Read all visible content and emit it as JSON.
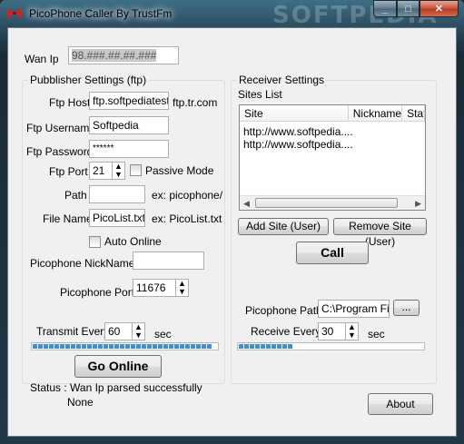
{
  "window": {
    "title": "PicoPhone Caller By TrustFm",
    "watermark": "SOFTPEDIA",
    "icon": "red-bowtie-icon",
    "minimize_icon": "minimize-icon",
    "maximize_icon": "maximize-icon",
    "close_icon": "close-icon",
    "minimize_glyph": "_",
    "maximize_glyph": "□",
    "close_glyph": "✕"
  },
  "wan": {
    "label": "Wan Ip",
    "value": "98.###.##.##.### "
  },
  "publisher": {
    "title": "Pubblisher Settings (ftp)",
    "ftp_host_label": "Ftp Host",
    "ftp_host_value": "ftp.softpediatest.c",
    "ftp_host_suffix": "ftp.tr.com",
    "ftp_username_label": "Ftp Username",
    "ftp_username_value": "Softpedia",
    "ftp_password_label": "Ftp Password",
    "ftp_password_value": "******",
    "ftp_port_label": "Ftp Port",
    "ftp_port_value": "21",
    "passive_mode_label": "Passive Mode",
    "passive_mode_checked": false,
    "path_label": "Path",
    "path_value": "",
    "path_example": "ex: picophone/",
    "file_name_label": "File Name",
    "file_name_value": "PicoList.txt",
    "file_name_example": "ex: PicoList.txt",
    "auto_online_label": "Auto Online",
    "auto_online_checked": false,
    "nickname_label": "Picophone NickName",
    "nickname_value": "",
    "port_label": "Picophone Port",
    "port_value": "11676",
    "transmit_label": "Transmit Every",
    "transmit_value": "60",
    "transmit_unit": "sec",
    "progress_percent": 100,
    "go_online_label": "Go Online",
    "status_label": "Status :",
    "status_line1": "Wan Ip parsed successfully",
    "status_line2": "None"
  },
  "receiver": {
    "title": "Receiver Settings",
    "sites_list_label": "Sites List",
    "columns": [
      "Site",
      "Nickname",
      "Stat"
    ],
    "rows": [
      [
        "http://www.softpedia....",
        "",
        ""
      ],
      [
        "http://www.softpedia....",
        "",
        ""
      ]
    ],
    "add_site_label": "Add Site (User)",
    "remove_site_label": "Remove Site (User)",
    "call_label": "Call",
    "path_label": "Picophone Path",
    "path_value": "C:\\Program Files",
    "browse_label": "...",
    "receive_label": "Receive Every",
    "receive_value": "30",
    "receive_unit": "sec",
    "progress_percent": 30
  },
  "about_label": "About",
  "spin_glyph_up": "▲",
  "spin_glyph_down": "▼",
  "scroll_left_glyph": "◀",
  "scroll_right_glyph": "▶"
}
